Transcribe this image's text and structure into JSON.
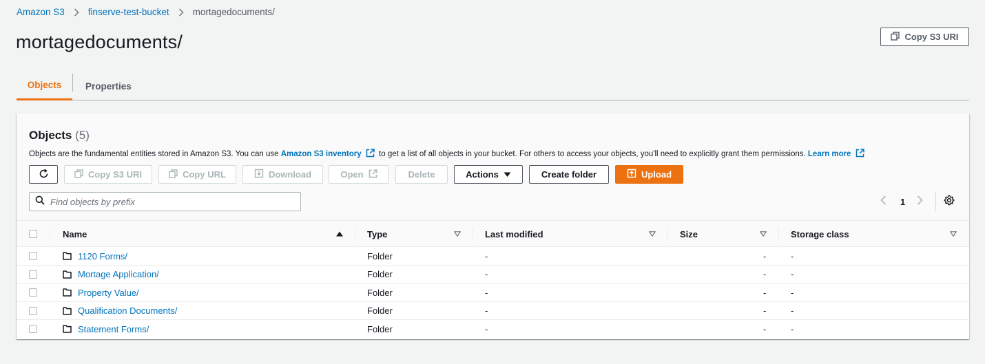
{
  "breadcrumb": {
    "items": [
      "Amazon S3",
      "finserve-test-bucket"
    ],
    "current": "mortagedocuments/"
  },
  "page": {
    "title": "mortagedocuments/",
    "copy_uri_label": "Copy S3 URI"
  },
  "tabs": [
    {
      "label": "Objects",
      "active": true
    },
    {
      "label": "Properties",
      "active": false
    }
  ],
  "objects_panel": {
    "title": "Objects",
    "count": "(5)",
    "description_prefix": "Objects are the fundamental entities stored in Amazon S3. You can use",
    "inventory_link": "Amazon S3 inventory",
    "description_middle": "to get a list of all objects in your bucket. For others to access your objects, you'll need to explicitly grant them permissions.",
    "learn_more": "Learn more"
  },
  "toolbar": {
    "copy_s3_uri": "Copy S3 URI",
    "copy_url": "Copy URL",
    "download": "Download",
    "open": "Open",
    "delete": "Delete",
    "actions": "Actions",
    "create_folder": "Create folder",
    "upload": "Upload"
  },
  "search": {
    "placeholder": "Find objects by prefix",
    "value": ""
  },
  "pagination": {
    "current_page": "1"
  },
  "table": {
    "columns": [
      "Name",
      "Type",
      "Last modified",
      "Size",
      "Storage class"
    ],
    "rows": [
      {
        "name": "1120 Forms/",
        "type": "Folder",
        "last_modified": "-",
        "size": "-",
        "storage_class": "-"
      },
      {
        "name": "Mortage Application/",
        "type": "Folder",
        "last_modified": "-",
        "size": "-",
        "storage_class": "-"
      },
      {
        "name": "Property Value/",
        "type": "Folder",
        "last_modified": "-",
        "size": "-",
        "storage_class": "-"
      },
      {
        "name": "Qualification Documents/",
        "type": "Folder",
        "last_modified": "-",
        "size": "-",
        "storage_class": "-"
      },
      {
        "name": "Statement Forms/",
        "type": "Folder",
        "last_modified": "-",
        "size": "-",
        "storage_class": "-"
      }
    ]
  },
  "colors": {
    "link": "#0073bb",
    "accent": "#ec7211",
    "text": "#16191f",
    "muted": "#545b64",
    "background": "#f2f3f3"
  },
  "icons": {
    "breadcrumb_separator": "chevron-right-icon",
    "copy": "copy-icon",
    "refresh": "refresh-icon",
    "download": "download-icon",
    "external": "external-link-icon",
    "caret": "caret-down-icon",
    "upload": "upload-icon",
    "search": "search-icon",
    "settings": "gear-icon",
    "folder": "folder-icon",
    "sort_asc": "sort-ascending-icon",
    "sort_filter": "sort-caret-icon"
  }
}
